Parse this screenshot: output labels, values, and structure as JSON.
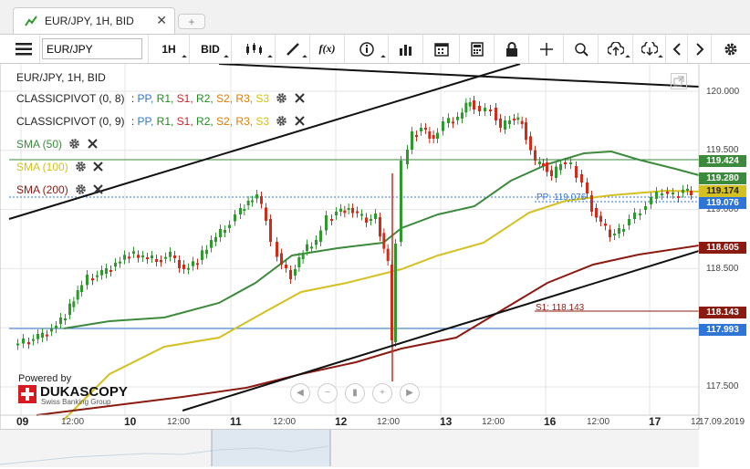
{
  "tab": {
    "title": "EUR/JPY, 1H, BID",
    "new_tab": "+",
    "close": "✕"
  },
  "toolbar": {
    "menu_icon": "hamburger-icon",
    "symbol_value": "EUR/JPY",
    "period_label": "1H",
    "side_label": "BID",
    "tools": [
      "candles-icon",
      "pencil-icon",
      "fx-icon",
      "info-icon",
      "bars-icon",
      "calendar-icon",
      "calculator-icon",
      "lock-icon",
      "crosshair-icon",
      "zoom-icon",
      "upload-icon",
      "download-icon",
      "prev-icon",
      "next-icon",
      "gear-icon"
    ],
    "fx_label": "f(x)"
  },
  "legend": {
    "title": "EUR/JPY, 1H, BID",
    "pivot1_name": "CLASSICPIVOT (0, 8)",
    "pivot2_name": "CLASSICPIVOT (0, 9)",
    "pivot_colon": ":",
    "pivot_levels": [
      {
        "label": "PP",
        "color": "#2e75d6"
      },
      {
        "label": "R1",
        "color": "#1f8a1f"
      },
      {
        "label": "S1",
        "color": "#d62020"
      },
      {
        "label": "R2",
        "color": "#1f8a1f"
      },
      {
        "label": "S2",
        "color": "#e07b00"
      },
      {
        "label": "R3",
        "color": "#e07b00"
      },
      {
        "label": "S3",
        "color": "#d4c400"
      }
    ],
    "sma50": "SMA (50)",
    "sma100": "SMA (100)",
    "sma200": "SMA (200)"
  },
  "colors": {
    "sma50": "#3c8a3c",
    "sma100": "#d4c020",
    "sma200": "#8b1a10",
    "up": "#2e9a2e",
    "down": "#d42a1a",
    "grid": "#e6e6e6"
  },
  "price_boxes": [
    {
      "value": "119.424",
      "color": "#3c8a3c"
    },
    {
      "value": "119.280",
      "color": "#3c8a3c"
    },
    {
      "value": "119.174",
      "color": "#d4c020"
    },
    {
      "value": "119.076",
      "color": "#2e75d6"
    },
    {
      "value": "118.605",
      "color": "#8b1a10"
    },
    {
      "value": "118.143",
      "color": "#8b1a10"
    },
    {
      "value": "117.993",
      "color": "#2e75d6"
    }
  ],
  "pivot_labels": {
    "pp": "PP: 119.076",
    "s1": "S1: 118.143"
  },
  "y_ticks": [
    "120.000",
    "119.500",
    "119.000",
    "118.500",
    "117.500"
  ],
  "x_labels": [
    {
      "text": "09",
      "big": true
    },
    {
      "text": "12:00",
      "big": false
    },
    {
      "text": "10",
      "big": true
    },
    {
      "text": "12:00",
      "big": false
    },
    {
      "text": "11",
      "big": true
    },
    {
      "text": "12:00",
      "big": false
    },
    {
      "text": "12",
      "big": true
    },
    {
      "text": "12:00",
      "big": false
    },
    {
      "text": "13",
      "big": true
    },
    {
      "text": "12:00",
      "big": false
    },
    {
      "text": "16",
      "big": true
    },
    {
      "text": "12:00",
      "big": false
    },
    {
      "text": "17",
      "big": true
    },
    {
      "text": "12",
      "big": false
    },
    {
      "text": "17.09.2019",
      "big": false
    }
  ],
  "branding": {
    "powered_by": "Powered by",
    "name": "DUKASCOPY",
    "sub": "Swiss Banking Group"
  },
  "nav_buttons": [
    "rewind-icon",
    "zoom-out-icon",
    "fit-icon",
    "zoom-in-icon",
    "play-icon"
  ]
}
